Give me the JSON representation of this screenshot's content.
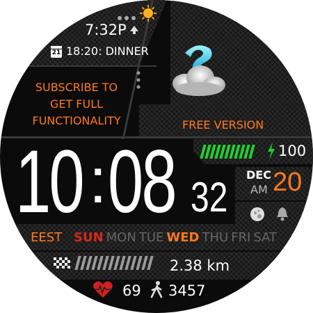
{
  "status": {
    "dots_icon": "three-dots-icon",
    "weather_icon": "sun-icon",
    "time": "7:32P",
    "time_icon": "arrow-up-icon"
  },
  "event": {
    "calendar_icon_day": "21",
    "text": "18:20: DINNER"
  },
  "promo": {
    "lines": [
      "SUBSCRIBE TO",
      "GET FULL",
      "FUNCTIONALITY"
    ],
    "free_version": "FREE VERSION",
    "weather_icon": "unknown-weather-icon"
  },
  "clock": {
    "hours": "10",
    "colon": ":",
    "minutes": "08",
    "seconds": "32"
  },
  "battery": {
    "level": 100,
    "value": "100",
    "icon": "charging-bolt-icon",
    "color": "#22d030"
  },
  "date": {
    "month": "DEC",
    "ampm": "AM",
    "day": "20"
  },
  "icons": {
    "moon": "moon-phase-icon",
    "alarm": "bell-icon"
  },
  "timezone": "EEST",
  "weekdays": [
    {
      "label": "SUN",
      "style": "sun"
    },
    {
      "label": "MON",
      "style": "off"
    },
    {
      "label": "TUE",
      "style": "off"
    },
    {
      "label": "WED",
      "style": "active"
    },
    {
      "label": "THU",
      "style": "off"
    },
    {
      "label": "FRI",
      "style": "off"
    },
    {
      "label": "SAT",
      "style": "off"
    }
  ],
  "distance": {
    "value": "2.38 km",
    "icon": "checkered-flag-icon"
  },
  "health": {
    "heart_icon": "heart-rate-icon",
    "heart_rate": "69",
    "steps_icon": "walking-icon",
    "steps": "3457"
  },
  "colors": {
    "accent": "#ff7a1e",
    "sunday": "#d42a1a",
    "inactive": "#7a7a7a",
    "battery": "#22d030"
  }
}
